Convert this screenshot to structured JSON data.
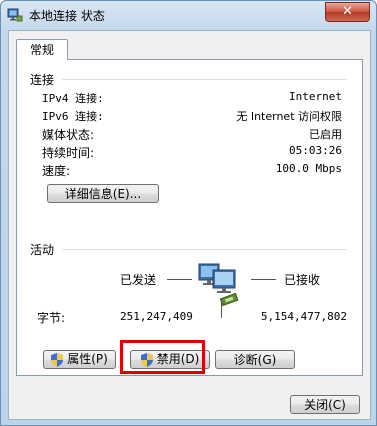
{
  "window": {
    "title": "本地连接 状态",
    "close_label": "✕"
  },
  "tab": {
    "label": "常规"
  },
  "connection": {
    "title": "连接",
    "rows": [
      {
        "label": "IPv4 连接:",
        "value": "Internet"
      },
      {
        "label": "IPv6 连接:",
        "value": "无 Internet 访问权限"
      },
      {
        "label": "媒体状态:",
        "value": "已启用"
      },
      {
        "label": "持续时间:",
        "value": "05:03:26"
      },
      {
        "label": "速度:",
        "value": "100.0 Mbps"
      }
    ],
    "details_button": "详细信息(E)..."
  },
  "activity": {
    "title": "活动",
    "sent_label": "已发送",
    "received_label": "已接收",
    "bytes_label": "字节:",
    "bytes_sent": "251,247,409",
    "bytes_received": "5,154,477,802"
  },
  "buttons": {
    "properties": "属性(P)",
    "disable": "禁用(D)",
    "diagnose": "诊断(G)",
    "close": "关闭(C)"
  },
  "colors": {
    "highlight": "#e00000",
    "title_bar": "#c4d8ec"
  }
}
